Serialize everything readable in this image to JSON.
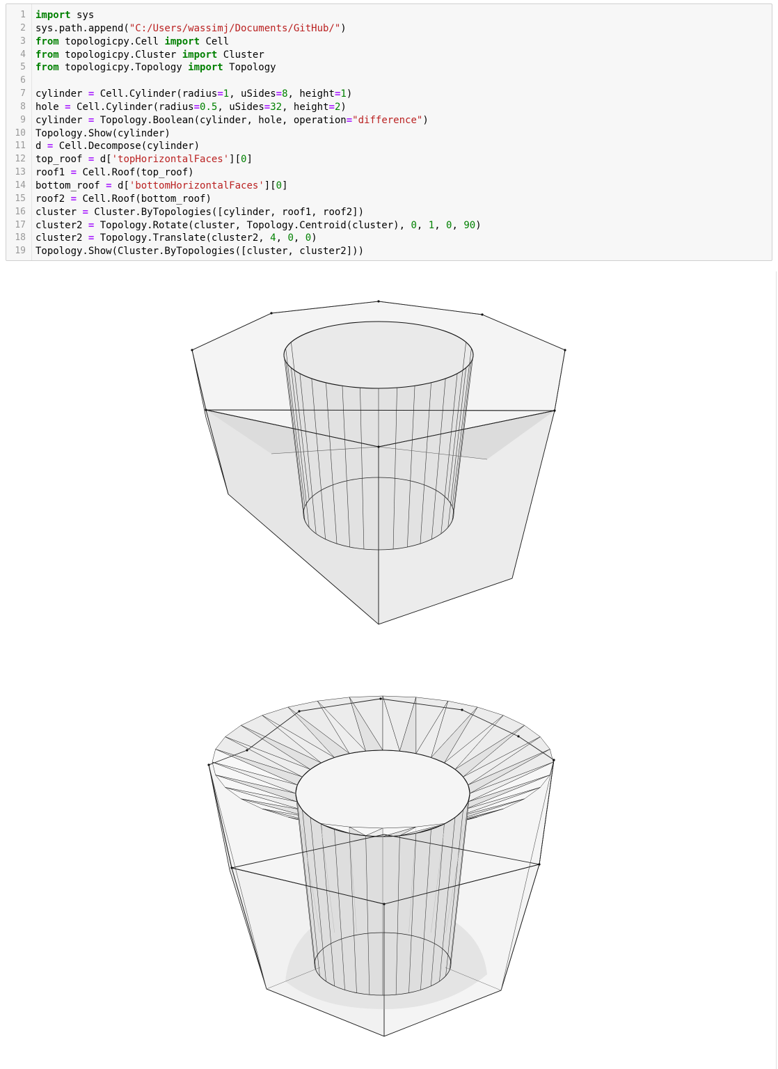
{
  "notebook": {
    "code_cell": {
      "lines": [
        {
          "n": "1",
          "tokens": [
            [
              "kw",
              "import"
            ],
            [
              "t",
              " sys"
            ]
          ]
        },
        {
          "n": "2",
          "tokens": [
            [
              "t",
              "sys.path.append("
            ],
            [
              "str",
              "\"C:/Users/wassimj/Documents/GitHub/\""
            ],
            [
              "t",
              ")"
            ]
          ]
        },
        {
          "n": "3",
          "tokens": [
            [
              "kw",
              "from"
            ],
            [
              "t",
              " topologicpy.Cell "
            ],
            [
              "kw",
              "import"
            ],
            [
              "t",
              " Cell"
            ]
          ]
        },
        {
          "n": "4",
          "tokens": [
            [
              "kw",
              "from"
            ],
            [
              "t",
              " topologicpy.Cluster "
            ],
            [
              "kw",
              "import"
            ],
            [
              "t",
              " Cluster"
            ]
          ]
        },
        {
          "n": "5",
          "tokens": [
            [
              "kw",
              "from"
            ],
            [
              "t",
              " topologicpy.Topology "
            ],
            [
              "kw",
              "import"
            ],
            [
              "t",
              " Topology"
            ]
          ]
        },
        {
          "n": "6",
          "tokens": []
        },
        {
          "n": "7",
          "tokens": [
            [
              "t",
              "cylinder "
            ],
            [
              "op",
              "="
            ],
            [
              "t",
              " Cell.Cylinder(radius"
            ],
            [
              "op",
              "="
            ],
            [
              "num",
              "1"
            ],
            [
              "t",
              ", uSides"
            ],
            [
              "op",
              "="
            ],
            [
              "num",
              "8"
            ],
            [
              "t",
              ", height"
            ],
            [
              "op",
              "="
            ],
            [
              "num",
              "1"
            ],
            [
              "t",
              ")"
            ]
          ]
        },
        {
          "n": "8",
          "tokens": [
            [
              "t",
              "hole "
            ],
            [
              "op",
              "="
            ],
            [
              "t",
              " Cell.Cylinder(radius"
            ],
            [
              "op",
              "="
            ],
            [
              "num",
              "0.5"
            ],
            [
              "t",
              ", uSides"
            ],
            [
              "op",
              "="
            ],
            [
              "num",
              "32"
            ],
            [
              "t",
              ", height"
            ],
            [
              "op",
              "="
            ],
            [
              "num",
              "2"
            ],
            [
              "t",
              ")"
            ]
          ]
        },
        {
          "n": "9",
          "tokens": [
            [
              "t",
              "cylinder "
            ],
            [
              "op",
              "="
            ],
            [
              "t",
              " Topology.Boolean(cylinder, hole, operation"
            ],
            [
              "op",
              "="
            ],
            [
              "str",
              "\"difference\""
            ],
            [
              "t",
              ")"
            ]
          ]
        },
        {
          "n": "10",
          "tokens": [
            [
              "t",
              "Topology.Show(cylinder)"
            ]
          ]
        },
        {
          "n": "11",
          "tokens": [
            [
              "t",
              "d "
            ],
            [
              "op",
              "="
            ],
            [
              "t",
              " Cell.Decompose(cylinder)"
            ]
          ]
        },
        {
          "n": "12",
          "tokens": [
            [
              "t",
              "top_roof "
            ],
            [
              "op",
              "="
            ],
            [
              "t",
              " d["
            ],
            [
              "str",
              "'topHorizontalFaces'"
            ],
            [
              "t",
              "]["
            ],
            [
              "num",
              "0"
            ],
            [
              "t",
              "]"
            ]
          ]
        },
        {
          "n": "13",
          "tokens": [
            [
              "t",
              "roof1 "
            ],
            [
              "op",
              "="
            ],
            [
              "t",
              " Cell.Roof(top_roof)"
            ]
          ]
        },
        {
          "n": "14",
          "tokens": [
            [
              "t",
              "bottom_roof "
            ],
            [
              "op",
              "="
            ],
            [
              "t",
              " d["
            ],
            [
              "str",
              "'bottomHorizontalFaces'"
            ],
            [
              "t",
              "]["
            ],
            [
              "num",
              "0"
            ],
            [
              "t",
              "]"
            ]
          ]
        },
        {
          "n": "15",
          "tokens": [
            [
              "t",
              "roof2 "
            ],
            [
              "op",
              "="
            ],
            [
              "t",
              " Cell.Roof(bottom_roof)"
            ]
          ]
        },
        {
          "n": "16",
          "tokens": [
            [
              "t",
              "cluster "
            ],
            [
              "op",
              "="
            ],
            [
              "t",
              " Cluster.ByTopologies([cylinder, roof1, roof2])"
            ]
          ]
        },
        {
          "n": "17",
          "tokens": [
            [
              "t",
              "cluster2 "
            ],
            [
              "op",
              "="
            ],
            [
              "t",
              " Topology.Rotate(cluster, Topology.Centroid(cluster), "
            ],
            [
              "num",
              "0"
            ],
            [
              "t",
              ", "
            ],
            [
              "num",
              "1"
            ],
            [
              "t",
              ", "
            ],
            [
              "num",
              "0"
            ],
            [
              "t",
              ", "
            ],
            [
              "num",
              "90"
            ],
            [
              "t",
              ")"
            ]
          ]
        },
        {
          "n": "18",
          "tokens": [
            [
              "t",
              "cluster2 "
            ],
            [
              "op",
              "="
            ],
            [
              "t",
              " Topology.Translate(cluster2, "
            ],
            [
              "num",
              "4"
            ],
            [
              "t",
              ", "
            ],
            [
              "num",
              "0"
            ],
            [
              "t",
              ", "
            ],
            [
              "num",
              "0"
            ],
            [
              "t",
              ")"
            ]
          ]
        },
        {
          "n": "19",
          "tokens": [
            [
              "t",
              "Topology.Show(Cluster.ByTopologies([cluster, cluster2]))"
            ]
          ]
        }
      ]
    },
    "output": {
      "figures": [
        {
          "name": "hollow-octagonal-cylinder",
          "sides": 8,
          "hole_sides": 32
        },
        {
          "name": "roofed-cluster",
          "sides": 8,
          "hole_sides": 32
        }
      ]
    }
  },
  "colors": {
    "keyword": "#008000",
    "operator": "#aa22ff",
    "string": "#ba2121",
    "number": "#008000",
    "line_number": "#999999",
    "cell_background": "#f7f7f7"
  }
}
